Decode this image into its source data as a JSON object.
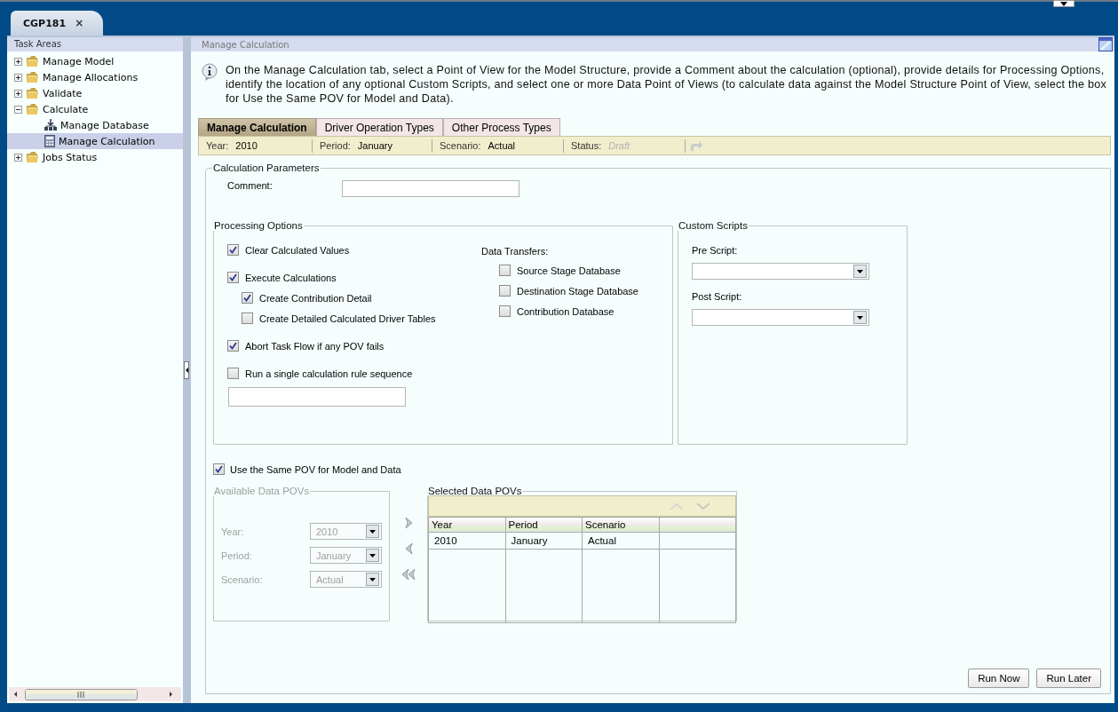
{
  "document_tab": {
    "label": "CGP181",
    "close": "×",
    "selected": true
  },
  "task_areas": {
    "title": "Task Areas",
    "items": [
      {
        "label": "Manage Model",
        "kind": "folder",
        "expanded": false,
        "selected": false
      },
      {
        "label": "Manage Allocations",
        "kind": "folder",
        "expanded": false,
        "selected": false
      },
      {
        "label": "Validate",
        "kind": "folder",
        "expanded": false,
        "selected": false
      },
      {
        "label": "Calculate",
        "kind": "folder",
        "expanded": true,
        "selected": false,
        "children": [
          {
            "label": "Manage Database",
            "kind": "database",
            "selected": false
          },
          {
            "label": "Manage Calculation",
            "kind": "calculator",
            "selected": true
          }
        ]
      },
      {
        "label": "Jobs Status",
        "kind": "folder",
        "expanded": false,
        "selected": false
      }
    ]
  },
  "page": {
    "title": "Manage Calculation",
    "info": "On the Manage Calculation tab, select a Point of View for the Model Structure, provide a Comment about the calculation (optional), provide details for Processing Options, identify the location of any optional Custom Scripts, and select one or more Data Point of Views (to calculate data against the Model Structure Point of View, select the box for Use the Same POV for Model and Data)."
  },
  "tabs": [
    {
      "label": "Manage Calculation",
      "selected": true
    },
    {
      "label": "Driver Operation Types",
      "selected": false
    },
    {
      "label": "Other Process Types",
      "selected": false
    }
  ],
  "pov_bar": [
    {
      "label": "Year:",
      "value": "2010",
      "kind": "plain"
    },
    {
      "label": "Period:",
      "value": "January",
      "kind": "plain"
    },
    {
      "label": "Scenario:",
      "value": "Actual",
      "kind": "plain"
    },
    {
      "label": "Status:",
      "value": "Draft",
      "kind": "status"
    }
  ],
  "calculation_parameters": {
    "title": "Calculation Parameters",
    "comment_label": "Comment:"
  },
  "processing_options": {
    "title": "Processing Options",
    "options": [
      {
        "label": "Clear Calculated Values",
        "checked": true
      },
      {
        "label": "Execute Calculations",
        "checked": true,
        "children": [
          {
            "label": "Create Contribution Detail",
            "checked": true
          },
          {
            "label": "Create Detailed Calculated Driver Tables",
            "checked": false
          }
        ]
      },
      {
        "label": "Abort Task Flow if any POV fails",
        "checked": true
      },
      {
        "label": "Run a single calculation rule sequence",
        "checked": false
      }
    ],
    "data_transfers": {
      "label": "Data Transfers:",
      "options": [
        {
          "label": "Source Stage Database",
          "checked": false
        },
        {
          "label": "Destination Stage Database",
          "checked": false
        },
        {
          "label": "Contribution Database",
          "checked": false
        }
      ]
    }
  },
  "custom_scripts": {
    "title": "Custom Scripts",
    "fields": [
      {
        "label": "Pre Script:"
      },
      {
        "label": "Post Script:"
      }
    ]
  },
  "same_pov": {
    "label": "Use the Same POV for Model and Data",
    "checked": true
  },
  "available_data_povs": {
    "title": "Available Data POVs",
    "disabled": true,
    "fields": [
      {
        "label": "Year:",
        "value": "2010"
      },
      {
        "label": "Period:",
        "value": "January"
      },
      {
        "label": "Scenario:",
        "value": "Actual"
      }
    ]
  },
  "selected_data_povs": {
    "title": "Selected Data POVs",
    "columns": [
      "Year",
      "Period",
      "Scenario"
    ],
    "rows": [
      [
        "2010",
        "January",
        "Actual"
      ]
    ]
  },
  "buttons": [
    "Run Now",
    "Run Later"
  ]
}
